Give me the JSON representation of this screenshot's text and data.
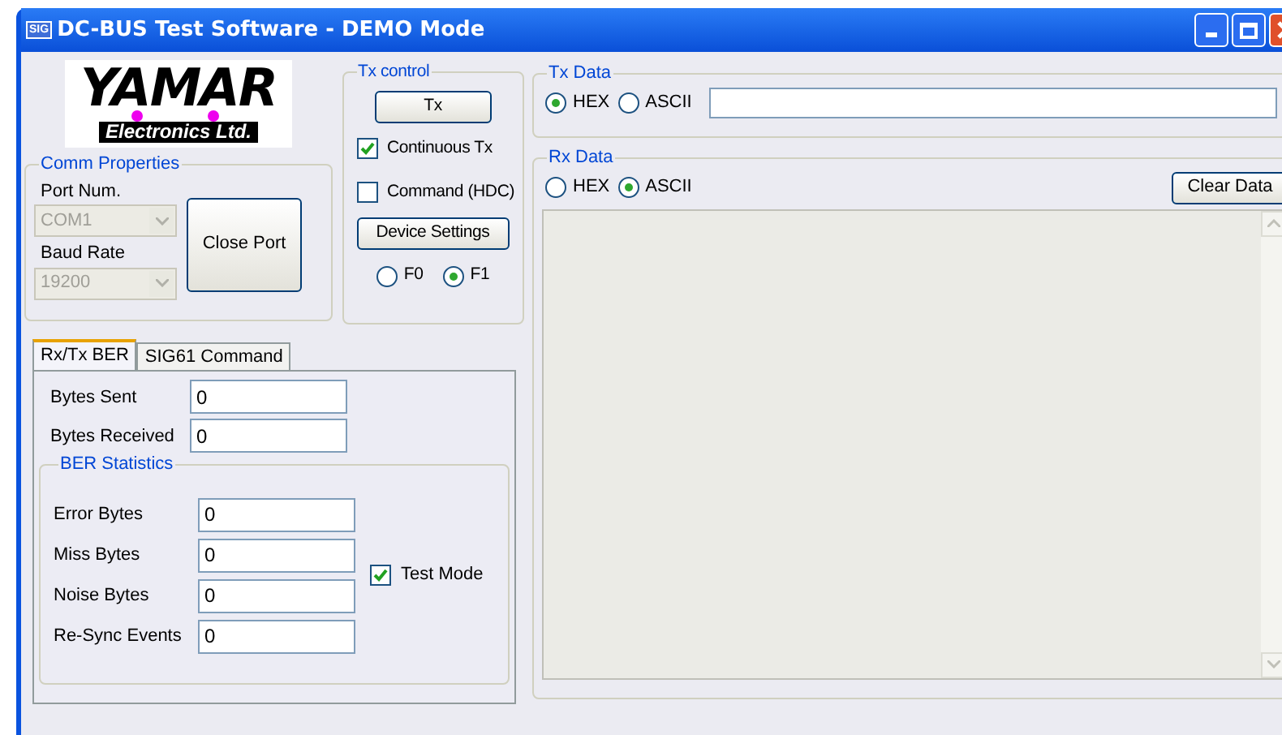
{
  "window": {
    "title": "DC-BUS Test Software - DEMO Mode",
    "app_icon": "SIG"
  },
  "logo": {
    "name": "YAMAR",
    "subtitle": "Electronics Ltd."
  },
  "comm_properties": {
    "title": "Comm Properties",
    "port_label": "Port Num.",
    "port_value": "COM1",
    "baud_label": "Baud Rate",
    "baud_value": "19200",
    "disabled": true,
    "close_button": "Close Port"
  },
  "tx_control": {
    "title": "Tx control",
    "tx_button": "Tx",
    "checkboxes": [
      {
        "label": "Continuous Tx",
        "checked": true
      },
      {
        "label": "Command (HDC)",
        "checked": false
      }
    ],
    "device_button": "Device Settings",
    "radios": [
      {
        "label": "F0",
        "selected": false
      },
      {
        "label": "F1",
        "selected": true
      }
    ]
  },
  "tx_data": {
    "title": "Tx Data",
    "radios": [
      {
        "label": "HEX",
        "selected": true
      },
      {
        "label": "ASCII",
        "selected": false
      }
    ]
  },
  "rx_data": {
    "title": "Rx Data",
    "radios": [
      {
        "label": "HEX",
        "selected": false
      },
      {
        "label": "ASCII",
        "selected": true
      }
    ],
    "clear_button": "Clear Data"
  },
  "tabs": [
    {
      "label": "Rx/Tx BER",
      "selected": true
    },
    {
      "label": "SIG61 Command",
      "selected": false
    }
  ],
  "ber": {
    "fields": [
      {
        "label": "Bytes Sent",
        "value": "0"
      },
      {
        "label": "Bytes Received",
        "value": "0"
      }
    ],
    "statistics": {
      "title": "BER Statistics",
      "fields": [
        {
          "label": "Error Bytes",
          "value": "0"
        },
        {
          "label": "Miss Bytes",
          "value": "0"
        },
        {
          "label": "Noise Bytes",
          "value": "0"
        },
        {
          "label": "Re-Sync Events",
          "value": "0"
        }
      ],
      "test_mode": {
        "label": "Test Mode",
        "checked": true
      }
    }
  }
}
